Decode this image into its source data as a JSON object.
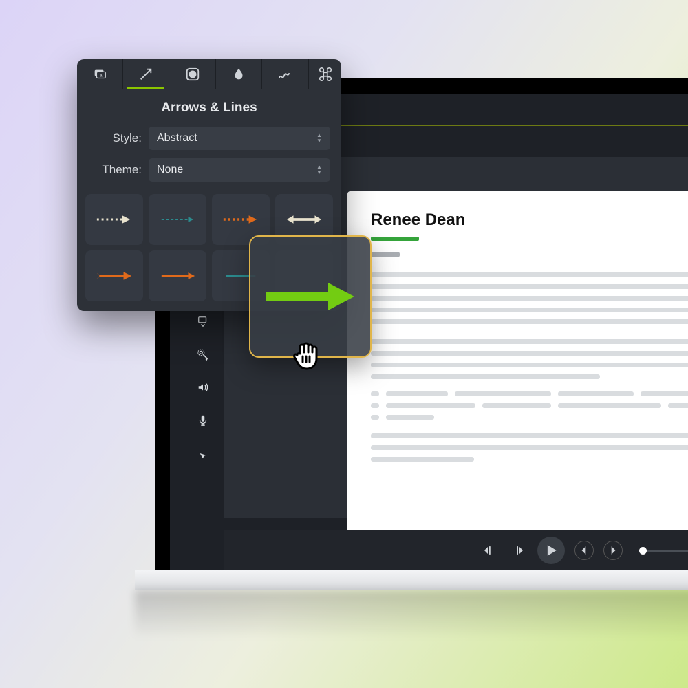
{
  "popover": {
    "title": "Arrows & Lines",
    "style_label": "Style:",
    "style_value": "Abstract",
    "theme_label": "Theme:",
    "theme_value": "None",
    "tabs": [
      "callout",
      "arrow",
      "shape",
      "blur",
      "scribble",
      "shortcut"
    ]
  },
  "slide": {
    "presenter": "Renee Dean"
  },
  "colors": {
    "accent": "#8BC500",
    "orange": "#E06A1B",
    "teal": "#2C8C8F"
  }
}
